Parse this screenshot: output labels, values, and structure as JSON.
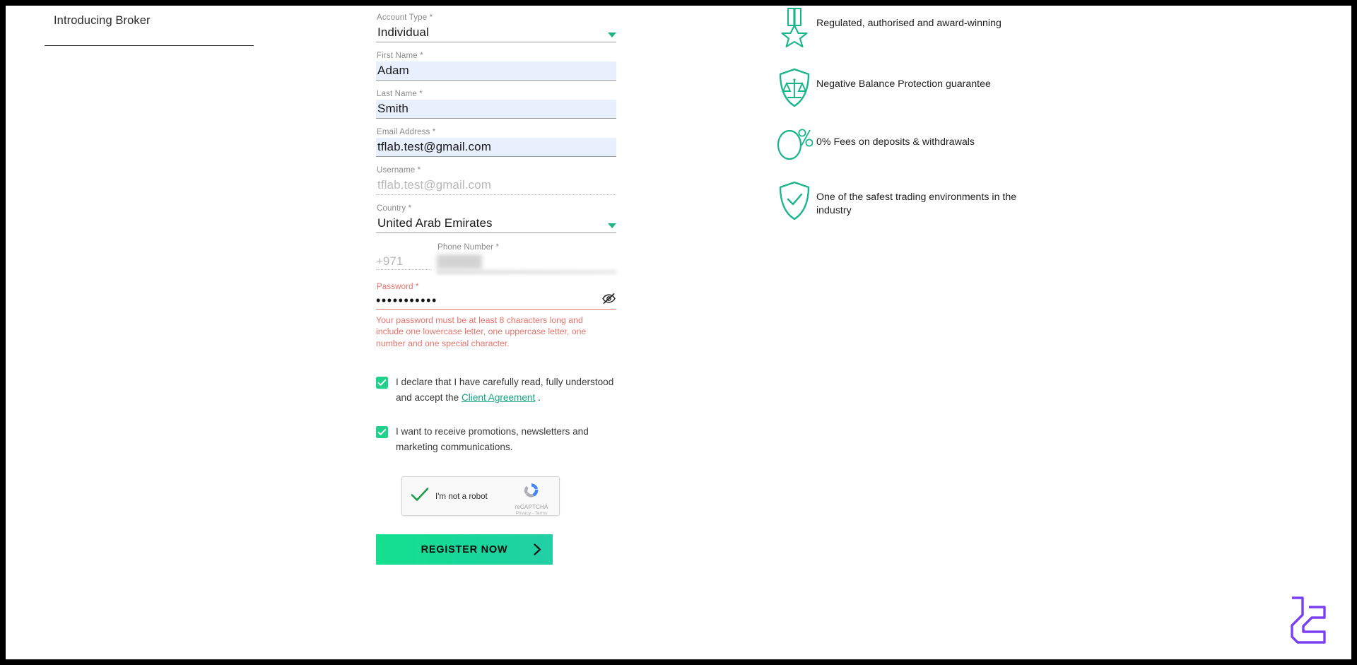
{
  "left_panel": {
    "heading": "Introducing Broker"
  },
  "form": {
    "fields": [
      {
        "label": "Account Type *",
        "value": "Individual",
        "state": "select"
      },
      {
        "label": "First Name *",
        "value": "Adam",
        "state": "autofilled"
      },
      {
        "label": "Last Name *",
        "value": "Smith",
        "state": "autofilled"
      },
      {
        "label": "Email Address *",
        "value": "tflab.test@gmail.com",
        "state": "autofilled"
      },
      {
        "label": "Username *",
        "value": "tflab.test@gmail.com",
        "state": "disabled"
      },
      {
        "label": "Country *",
        "value": "United Arab Emirates",
        "state": "select"
      }
    ],
    "phone": {
      "code_label": "",
      "code_value": "+971",
      "number_label": "Phone Number *",
      "number_value": ""
    },
    "password": {
      "label": "Password *",
      "value": "•••••••••••",
      "error": "Your password must be at least 8 characters long and include one lowercase letter, one uppercase letter, one number and one special character."
    },
    "checkboxes": [
      {
        "checked": true,
        "text_before": "I declare that I have carefully read, fully understood and accept the ",
        "link_text": "Client Agreement",
        "text_after": " ."
      },
      {
        "checked": true,
        "text_before": "I want to receive promotions, newsletters and marketing communications.",
        "link_text": "",
        "text_after": ""
      }
    ],
    "recaptcha": {
      "label": "I'm not a robot",
      "brand": "reCAPTCHA",
      "legal": "Privacy - Terms",
      "checked": true
    },
    "submit": {
      "label": "REGISTER NOW"
    }
  },
  "benefits": [
    {
      "icon": "medal-icon",
      "text": "Regulated, authorised and award-winning"
    },
    {
      "icon": "shield-scales-icon",
      "text": "Negative Balance Protection guarantee"
    },
    {
      "icon": "zero-percent-icon",
      "text": "0% Fees on deposits & withdrawals"
    },
    {
      "icon": "shield-check-icon",
      "text": "One of the safest trading environments in the industry"
    }
  ],
  "colors": {
    "accent_green": "#1fd18c",
    "teal_icon": "#16b58a",
    "error_red": "#e8726a",
    "autofill_blue": "#e8f0fe",
    "logo_purple": "#7b3ff2"
  }
}
